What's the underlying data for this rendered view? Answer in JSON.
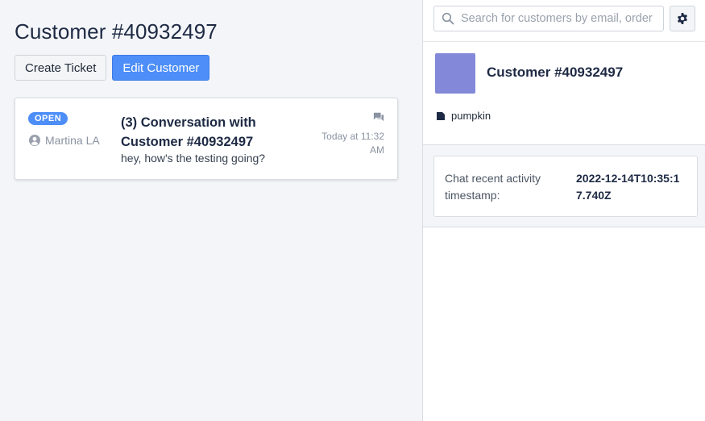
{
  "main": {
    "title": "Customer #40932497",
    "actions": {
      "create_ticket": "Create Ticket",
      "edit_customer": "Edit Customer"
    },
    "conversation": {
      "status": "OPEN",
      "agent": "Martina LA",
      "title": "(3) Conversation with Customer #40932497",
      "preview": "hey, how's the testing going?",
      "time": "Today at 11:32 AM",
      "icon": "chat-icon"
    }
  },
  "sidebar": {
    "search": {
      "placeholder": "Search for customers by email, order",
      "value": ""
    },
    "settings_icon": "gear-icon",
    "profile": {
      "name": "Customer #40932497",
      "avatar_color": "#8389d8",
      "tag": "pumpkin"
    },
    "attributes": [
      {
        "label": "Chat recent activity timestamp:",
        "value": "2022-12-14T10:35:17.740Z"
      }
    ]
  },
  "colors": {
    "primary": "#4d8ef8",
    "background": "#f3f5f8",
    "text": "#1e2a44"
  }
}
